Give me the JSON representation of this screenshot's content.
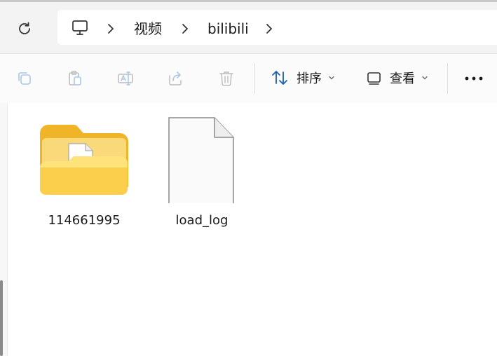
{
  "address_bar": {
    "breadcrumb": [
      {
        "icon": "computer-icon"
      },
      {
        "label": "视频"
      },
      {
        "label": "bilibili"
      }
    ]
  },
  "toolbar": {
    "icons": [
      "copy-icon",
      "paste-icon",
      "rename-icon",
      "share-icon",
      "delete-icon"
    ],
    "sort_label": "排序",
    "view_label": "查看",
    "more_icon": "more-icon"
  },
  "files": [
    {
      "name": "114661995",
      "type": "folder"
    },
    {
      "name": "load_log",
      "type": "file"
    }
  ],
  "colors": {
    "folder_yellow": "#f5c542",
    "accent_blue": "#2a6fd1"
  }
}
